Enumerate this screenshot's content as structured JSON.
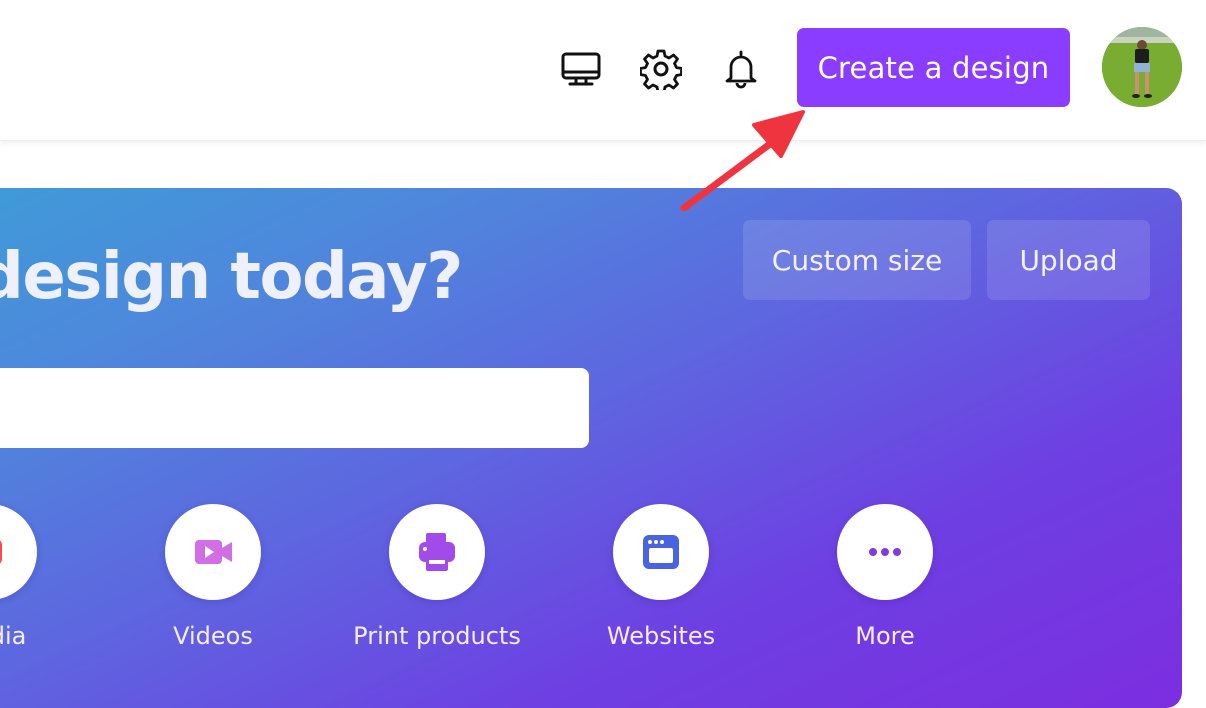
{
  "topbar": {
    "icons": [
      {
        "name": "desktop-app-icon",
        "label": "Desktop app"
      },
      {
        "name": "settings-gear-icon",
        "label": "Settings"
      },
      {
        "name": "notifications-bell-icon",
        "label": "Notifications"
      }
    ],
    "create_button_label": "Create a design",
    "avatar_alt": "User profile photo"
  },
  "hero": {
    "headline": "design today?",
    "search_placeholder": "",
    "custom_size_label": "Custom size",
    "upload_label": "Upload",
    "categories": [
      {
        "label": "media",
        "icon": "social-media-icon",
        "color": "#ff4a4a"
      },
      {
        "label": "Videos",
        "icon": "video-camera-icon",
        "color": "#d26ee3"
      },
      {
        "label": "Print products",
        "icon": "printer-icon",
        "color": "#a24bea"
      },
      {
        "label": "Websites",
        "icon": "browser-window-icon",
        "color": "#4a64e0"
      },
      {
        "label": "More",
        "icon": "more-dots-icon",
        "color": "#7d3edc"
      }
    ]
  },
  "annotation": {
    "type": "arrow",
    "color": "#f0343f",
    "points_to": "create-design-button"
  },
  "colors": {
    "brand_purple": "#8b3dff",
    "gradient_start": "#3f9bd8",
    "gradient_end": "#7c2ee0"
  }
}
